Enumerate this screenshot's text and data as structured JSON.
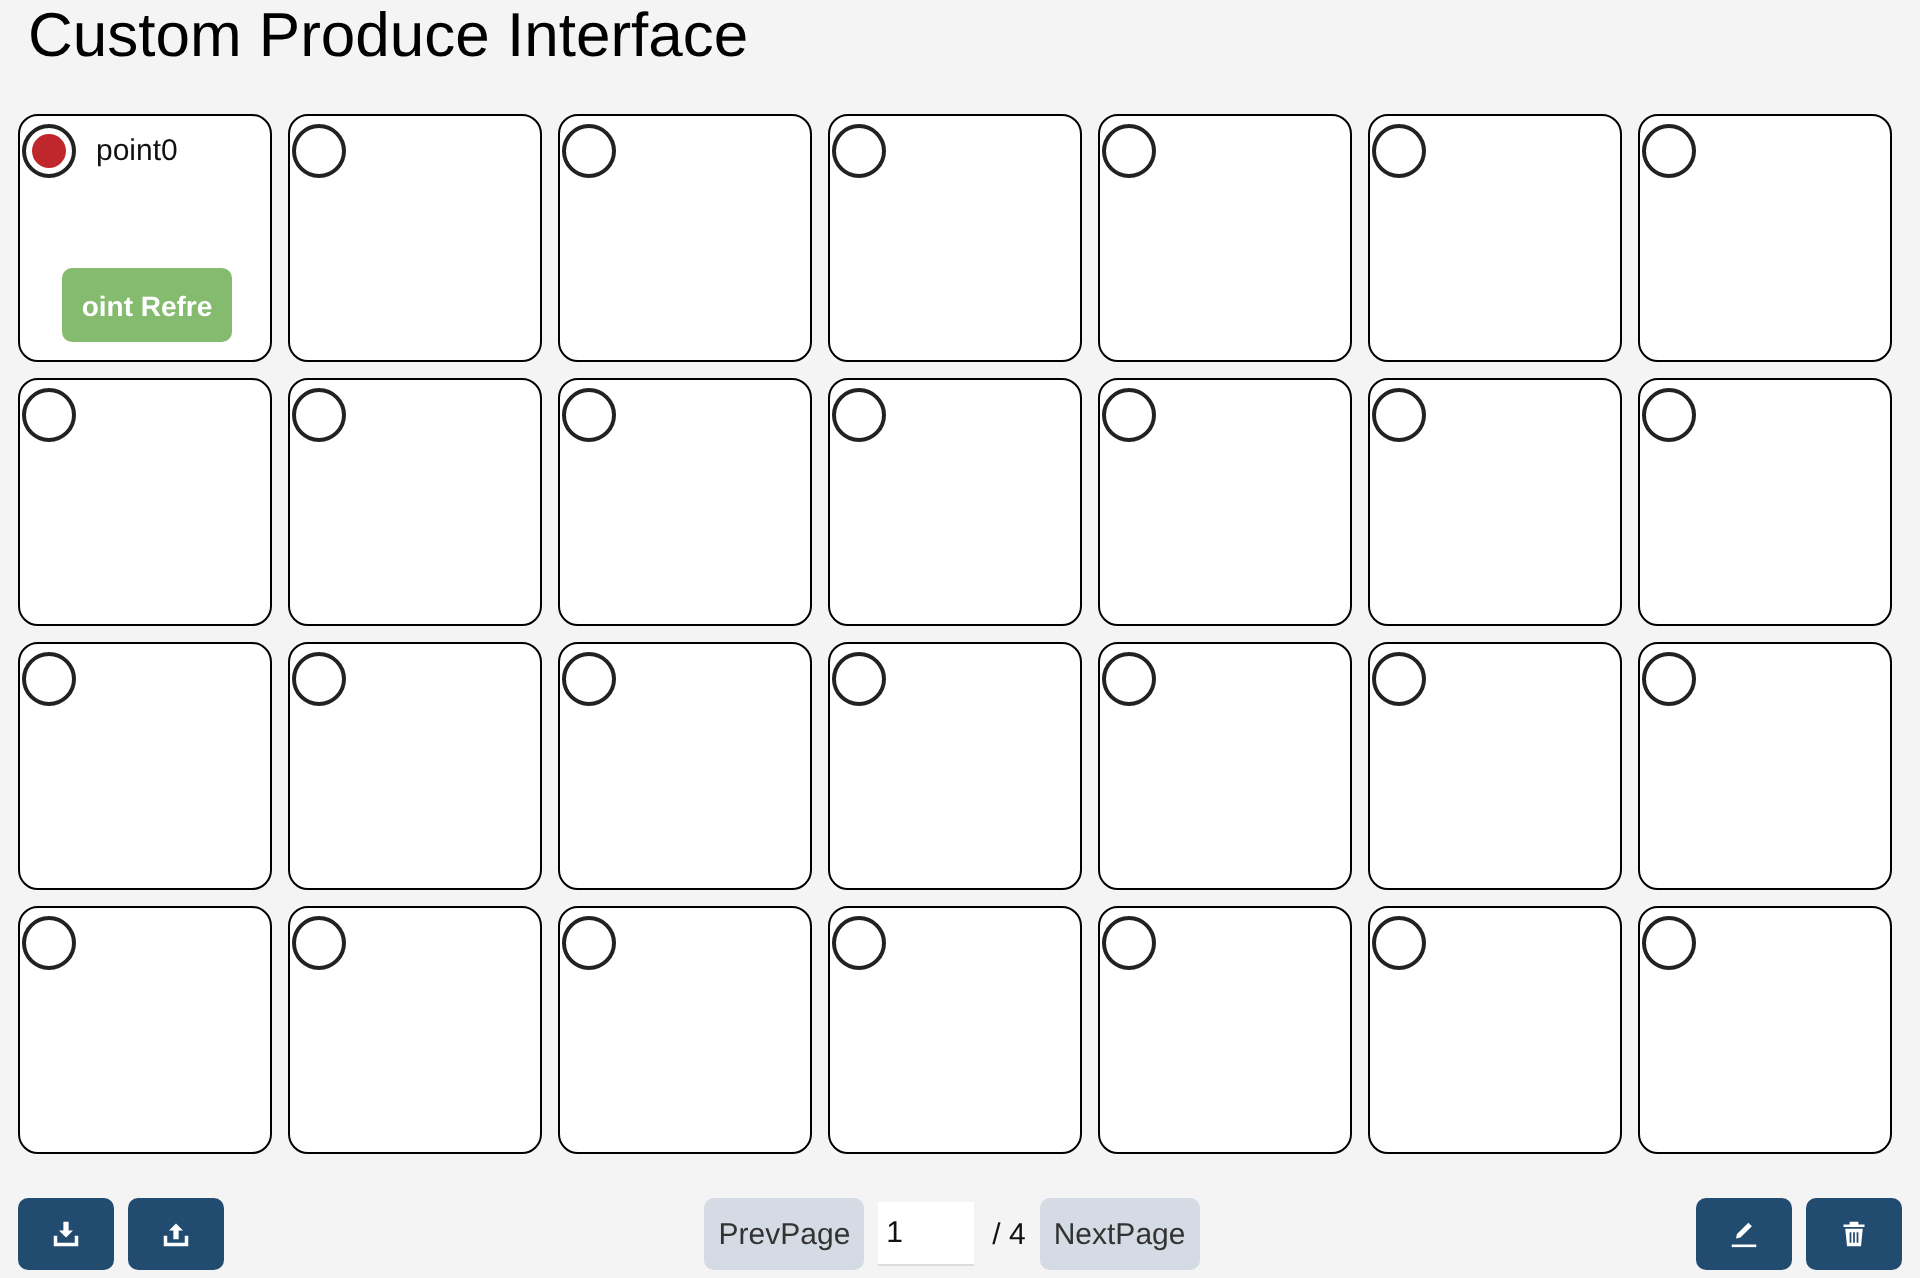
{
  "title": "Custom Produce Interface",
  "points": [
    {
      "selected": true,
      "label": "point0",
      "button": "oint Refre"
    },
    {
      "selected": false
    },
    {
      "selected": false
    },
    {
      "selected": false
    },
    {
      "selected": false
    },
    {
      "selected": false
    },
    {
      "selected": false
    },
    {
      "selected": false
    },
    {
      "selected": false
    },
    {
      "selected": false
    },
    {
      "selected": false
    },
    {
      "selected": false
    },
    {
      "selected": false
    },
    {
      "selected": false
    },
    {
      "selected": false
    },
    {
      "selected": false
    },
    {
      "selected": false
    },
    {
      "selected": false
    },
    {
      "selected": false
    },
    {
      "selected": false
    },
    {
      "selected": false
    },
    {
      "selected": false
    },
    {
      "selected": false
    },
    {
      "selected": false
    },
    {
      "selected": false
    },
    {
      "selected": false
    },
    {
      "selected": false
    },
    {
      "selected": false
    }
  ],
  "pagination": {
    "prev": "PrevPage",
    "page": "1",
    "total": "/ 4",
    "next": "NextPage"
  }
}
